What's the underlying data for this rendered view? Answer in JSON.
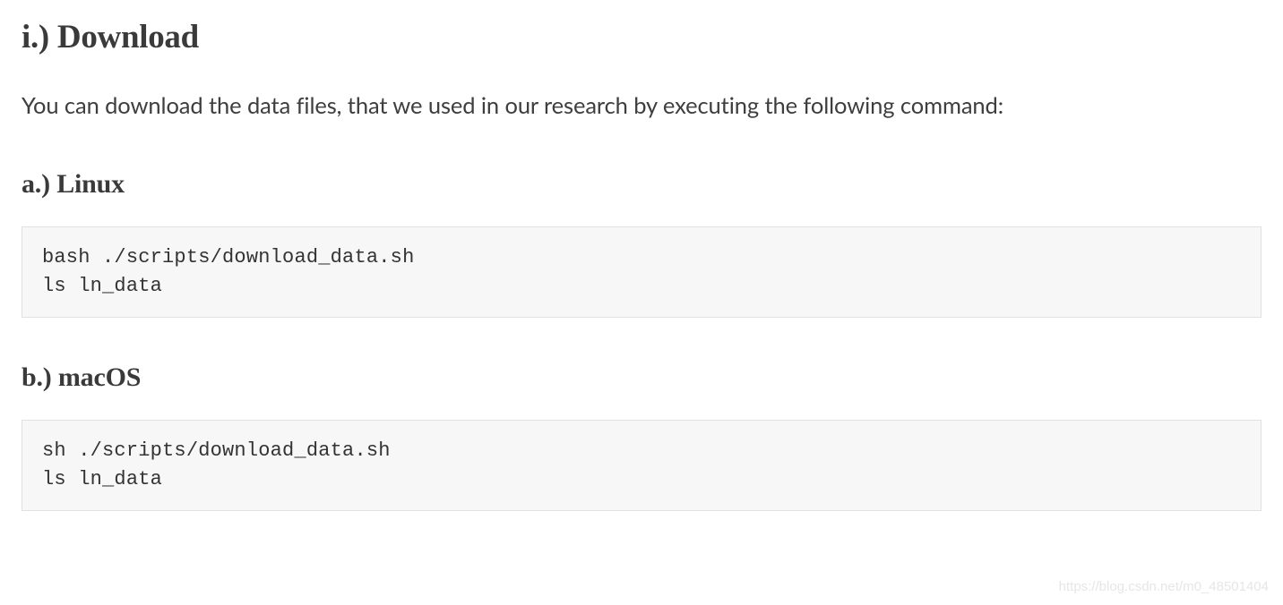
{
  "headings": {
    "download": "i.) Download",
    "linux": "a.) Linux",
    "macos": "b.) macOS"
  },
  "paragraphs": {
    "intro": "You can download the data files, that we used in our research by executing the following command:"
  },
  "code": {
    "linux": "bash ./scripts/download_data.sh\nls ln_data",
    "macos": "sh ./scripts/download_data.sh\nls ln_data"
  },
  "watermark": "https://blog.csdn.net/m0_48501404"
}
